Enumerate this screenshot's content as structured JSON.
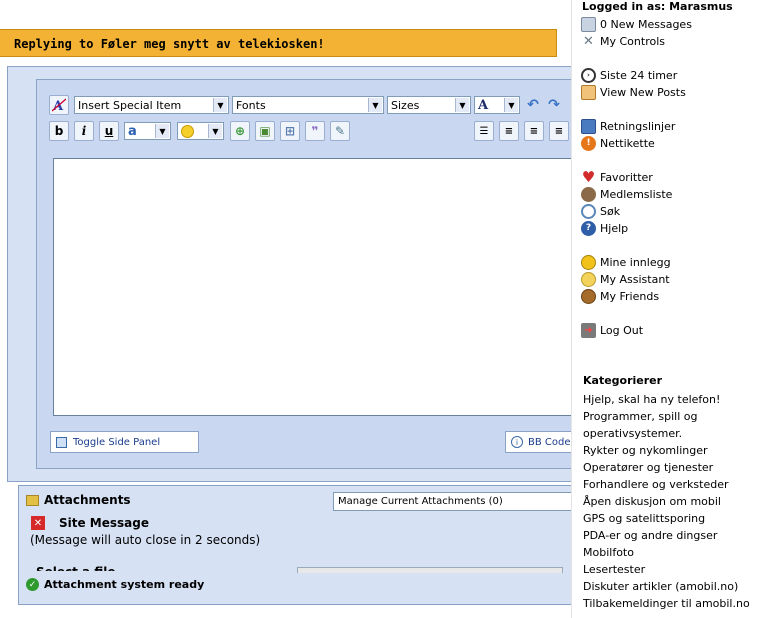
{
  "reply_title": "Replying to Føler meg snytt av telekiosken!",
  "toolbar": {
    "special_item": "Insert Special Item",
    "fonts": "Fonts",
    "sizes": "Sizes",
    "font_color_glyph": "A",
    "bold": "b",
    "italic": "i",
    "underline": "u",
    "highlight_glyph": "a"
  },
  "bottom": {
    "toggle_side_panel": "Toggle Side Panel",
    "bb_code": "BB Code"
  },
  "attachments": {
    "title": "Attachments",
    "manage": "Manage Current Attachments (0)",
    "site_message_title": "Site Message",
    "site_message_text": "(Message will auto close in 2 seconds)",
    "partial_label": "Select a file",
    "status": "Attachment system ready"
  },
  "sidebar": {
    "logged_in": "Logged in as: Marasmus",
    "group1": [
      {
        "icon": "envelope-icon",
        "label": "0 New Messages",
        "color": "#b9c6d8"
      },
      {
        "icon": "tools-icon",
        "label": "My Controls",
        "color": "#7d8a99"
      }
    ],
    "group2": [
      {
        "icon": "clock-icon",
        "label": "Siste 24 timer",
        "color": "#e2a020"
      },
      {
        "icon": "new-posts-icon",
        "label": "View New Posts",
        "color": "#e89a3c"
      }
    ],
    "group3": [
      {
        "icon": "guidelines-icon",
        "label": "Retningslinjer",
        "color": "#4a7bc0"
      },
      {
        "icon": "warning-icon",
        "label": "Nettikette",
        "color": "#e6761a"
      }
    ],
    "group4": [
      {
        "icon": "heart-icon",
        "label": "Favoritter",
        "color": "#d22b2b"
      },
      {
        "icon": "members-icon",
        "label": "Medlemsliste",
        "color": "#7a5c3c"
      },
      {
        "icon": "search-icon",
        "label": "Søk",
        "color": "#5a86b8"
      },
      {
        "icon": "help-icon",
        "label": "Hjelp",
        "color": "#2e5ea8"
      }
    ],
    "group5": [
      {
        "icon": "smiley-icon",
        "label": "Mine innlegg",
        "color": "#e8b21a"
      },
      {
        "icon": "assistant-icon",
        "label": "My Assistant",
        "color": "#e8c24a"
      },
      {
        "icon": "friends-icon",
        "label": "My Friends",
        "color": "#a56b2a"
      }
    ],
    "logout": {
      "icon": "logout-icon",
      "label": "Log Out",
      "color": "#c03030"
    },
    "categories_title": "Kategorierer",
    "categories": [
      "Hjelp, skal ha ny telefon!",
      "Programmer, spill og",
      "operativsystemer.",
      "Rykter og nykomlinger",
      "Operatører og tjenester",
      "Forhandlere og verksteder",
      "Åpen diskusjon om mobil",
      "GPS og satelittsporing",
      "PDA-er og andre dingser",
      "Mobilfoto",
      "Lesertester",
      "Diskuter artikler (amobil.no)",
      "Tilbakemeldinger til amobil.no"
    ]
  }
}
